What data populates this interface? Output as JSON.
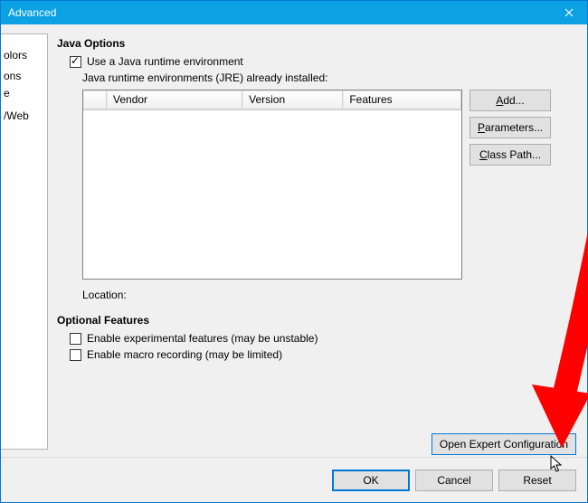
{
  "window": {
    "title": "Advanced"
  },
  "tree": {
    "items": [
      "",
      "",
      "",
      "",
      "",
      "",
      "",
      "olors",
      "",
      "",
      "ons",
      "e",
      "",
      "",
      "",
      "/Web"
    ]
  },
  "java": {
    "section": "Java Options",
    "use_jre_label": "Use a Java runtime environment",
    "use_jre_checked": true,
    "already_installed_label": "Java runtime environments (JRE) already installed:",
    "headers": {
      "vendor": "Vendor",
      "version": "Version",
      "features": "Features"
    },
    "location_label": "Location:"
  },
  "side": {
    "add": "Add...",
    "add_u": "A",
    "params": "Parameters...",
    "params_u": "P",
    "classpath": "Class Path...",
    "classpath_u": "C"
  },
  "optional": {
    "section": "Optional Features",
    "exp_label": "Enable experimental features (may be unstable)",
    "macro_label": "Enable macro recording (may be limited)"
  },
  "expert": {
    "label": "Open Expert Configuration"
  },
  "footer": {
    "ok": "OK",
    "cancel": "Cancel",
    "reset": "Reset"
  }
}
